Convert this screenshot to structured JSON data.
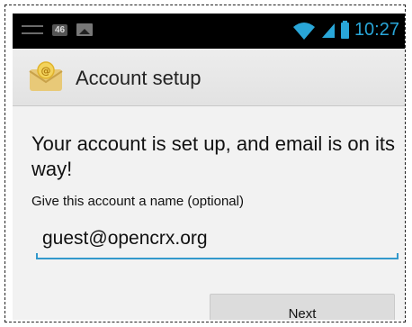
{
  "status_bar": {
    "badge": "46",
    "time": "10:27",
    "icons": [
      "usb-icon",
      "image-icon",
      "wifi-icon",
      "signal-icon",
      "battery-icon"
    ],
    "accent_color": "#29a6d8"
  },
  "action_bar": {
    "title": "Account setup",
    "icon": "email-envelope-icon"
  },
  "content": {
    "message": "Your account is set up, and email is on its way!",
    "name_hint": "Give this account a name (optional)",
    "account_name_value": "guest@opencrx.org"
  },
  "buttons": {
    "next_label": "Next"
  },
  "colors": {
    "input_underline": "#3399cc",
    "background": "#f2f2f2"
  }
}
